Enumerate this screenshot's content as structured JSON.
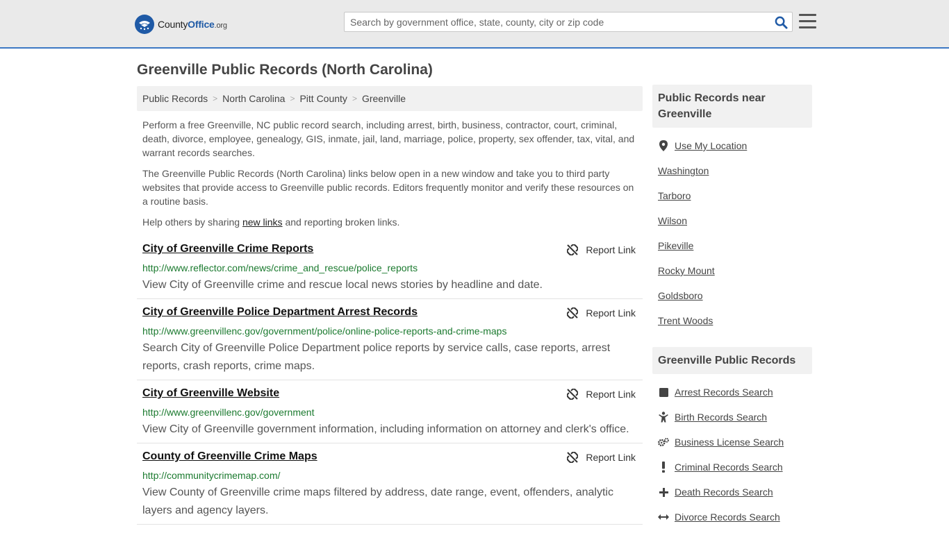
{
  "header": {
    "logo": {
      "brand_first": "County",
      "brand_second": "Office",
      "brand_tld": ".org"
    },
    "search": {
      "placeholder": "Search by government office, state, county, city or zip code"
    }
  },
  "page": {
    "title": "Greenville Public Records (North Carolina)"
  },
  "breadcrumb": [
    "Public Records",
    "North Carolina",
    "Pitt County",
    "Greenville"
  ],
  "intro": {
    "p1": "Perform a free Greenville, NC public record search, including arrest, birth, business, contractor, court, criminal, death, divorce, employee, genealogy, GIS, inmate, jail, land, marriage, police, property, sex offender, tax, vital, and warrant records searches.",
    "p2": "The Greenville Public Records (North Carolina) links below open in a new window and take you to third party websites that provide access to Greenville public records. Editors frequently monitor and verify these resources on a routine basis.",
    "p3_before": "Help others by sharing ",
    "p3_link": "new links",
    "p3_after": " and reporting broken links."
  },
  "report_label": "Report Link",
  "records": [
    {
      "title": "City of Greenville Crime Reports",
      "url": "http://www.reflector.com/news/crime_and_rescue/police_reports",
      "desc": "View City of Greenville crime and rescue local news stories by headline and date."
    },
    {
      "title": "City of Greenville Police Department Arrest Records",
      "url": "http://www.greenvillenc.gov/government/police/online-police-reports-and-crime-maps",
      "desc": "Search City of Greenville Police Department police reports by service calls, case reports, arrest reports, crash reports, crime maps."
    },
    {
      "title": "City of Greenville Website",
      "url": "http://www.greenvillenc.gov/government",
      "desc": "View City of Greenville government information, including information on attorney and clerk's office."
    },
    {
      "title": "County of Greenville Crime Maps",
      "url": "http://communitycrimemap.com/",
      "desc": "View County of Greenville crime maps filtered by address, date range, event, offenders, analytic layers and agency layers."
    }
  ],
  "sidebar": {
    "nearby_title": "Public Records near Greenville",
    "use_location": "Use My Location",
    "nearby": [
      "Washington",
      "Tarboro",
      "Wilson",
      "Pikeville",
      "Rocky Mount",
      "Goldsboro",
      "Trent Woods"
    ],
    "records_title": "Greenville Public Records",
    "record_links": [
      {
        "label": "Arrest Records Search",
        "icon": "square-icon"
      },
      {
        "label": "Birth Records Search",
        "icon": "child-icon"
      },
      {
        "label": "Business License Search",
        "icon": "gears-icon"
      },
      {
        "label": "Criminal Records Search",
        "icon": "exclamation-icon"
      },
      {
        "label": "Death Records Search",
        "icon": "plus-icon"
      },
      {
        "label": "Divorce Records Search",
        "icon": "arrows-h-icon"
      }
    ]
  },
  "colors": {
    "accent": "#3c78c3",
    "url_green": "#1b7a2f",
    "header_bg": "#eaeaea"
  }
}
